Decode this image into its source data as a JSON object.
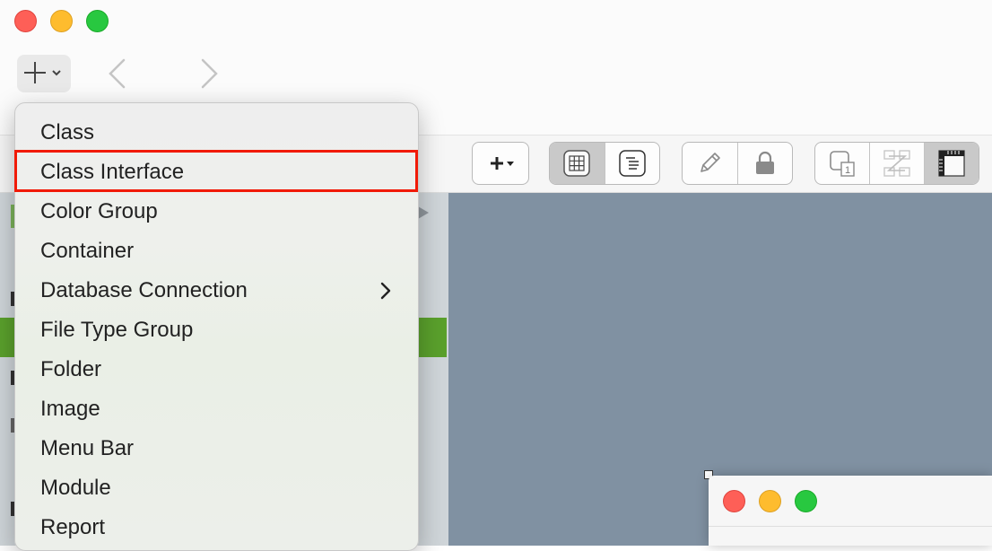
{
  "window": {
    "traffic_lights": [
      "close",
      "minimize",
      "zoom"
    ]
  },
  "navbar": {
    "add_icon": "plus-icon",
    "add_dropdown_icon": "chevron-down-icon",
    "back_icon": "chevron-left-icon",
    "forward_icon": "chevron-right-icon"
  },
  "toolbar": {
    "groups": [
      [
        "plus-dropdown-icon"
      ],
      [
        "grid-icon",
        "list-document-icon"
      ],
      [
        "pencil-icon",
        "lock-icon"
      ],
      [
        "layer-number-icon",
        "z-order-icon",
        "ruler-icon"
      ]
    ],
    "active_view": "grid-icon"
  },
  "menu": {
    "items": [
      {
        "label": "Class",
        "submenu": false
      },
      {
        "label": "Class Interface",
        "submenu": false,
        "highlighted": true
      },
      {
        "label": "Color Group",
        "submenu": false
      },
      {
        "label": "Container",
        "submenu": false
      },
      {
        "label": "Database Connection",
        "submenu": true
      },
      {
        "label": "File Type Group",
        "submenu": false
      },
      {
        "label": "Folder",
        "submenu": false
      },
      {
        "label": "Image",
        "submenu": false
      },
      {
        "label": "Menu Bar",
        "submenu": false
      },
      {
        "label": "Module",
        "submenu": false
      },
      {
        "label": "Report",
        "submenu": false
      }
    ],
    "highlight_color": "#f11a07"
  },
  "colors": {
    "sidebar_selection": "#5aa02c",
    "canvas": "#8091a2",
    "sidebar": "#cfd5d9"
  }
}
